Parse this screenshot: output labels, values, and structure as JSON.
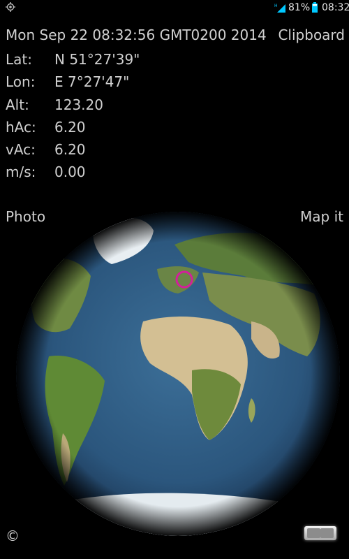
{
  "status_bar": {
    "battery": "81%",
    "time": "08:32",
    "signal_tag": "H"
  },
  "header": {
    "datetime": "Mon Sep 22 08:32:56 GMT0200 2014",
    "clipboard_label": "Clipboard"
  },
  "readings": [
    {
      "label": "Lat:",
      "value": "N 51°27'39\""
    },
    {
      "label": "Lon:",
      "value": "E 7°27'47\""
    },
    {
      "label": "Alt:",
      "value": "123.20"
    },
    {
      "label": "hAc:",
      "value": "6.20"
    },
    {
      "label": "vAc:",
      "value": "6.20"
    },
    {
      "label": "m/s:",
      "value": "0.00"
    }
  ],
  "actions": {
    "photo_label": "Photo",
    "map_label": "Map it"
  },
  "footer": {
    "copyright": "©"
  },
  "colors": {
    "background": "#000000",
    "text": "#d0d0d0",
    "marker": "#d2209a",
    "battery": "#00c8ff",
    "ocean": "#2f5b82"
  },
  "icons": [
    "gps-icon",
    "signal-icon",
    "battery-icon",
    "location-marker-icon"
  ]
}
